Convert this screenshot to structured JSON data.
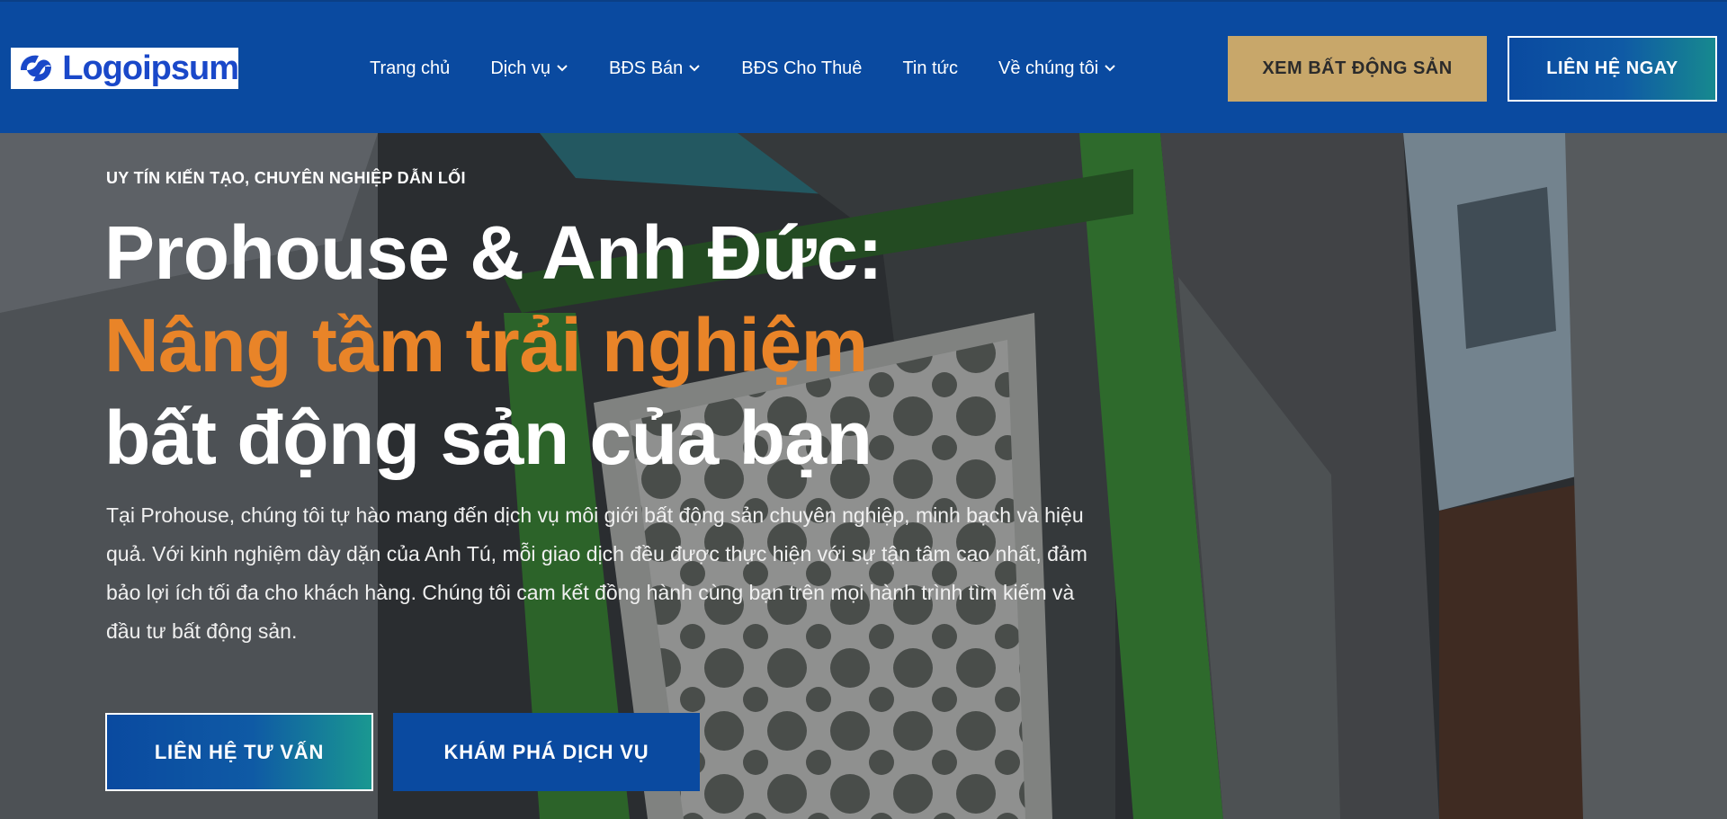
{
  "brand": {
    "logo_text": "Logoipsum",
    "primary_color": "#0a4aa0",
    "accent_gold": "#c8a76a",
    "accent_orange": "#e98428"
  },
  "nav": {
    "items": [
      {
        "label": "Trang chủ",
        "has_dropdown": false
      },
      {
        "label": "Dịch vụ",
        "has_dropdown": true
      },
      {
        "label": "BĐS Bán",
        "has_dropdown": true
      },
      {
        "label": "BĐS Cho Thuê",
        "has_dropdown": false
      },
      {
        "label": "Tin tức",
        "has_dropdown": false
      },
      {
        "label": "Về chúng tôi",
        "has_dropdown": true
      }
    ]
  },
  "header_buttons": {
    "view_property": "XEM BẤT ĐỘNG SẢN",
    "contact_now": "LIÊN HỆ NGAY"
  },
  "hero": {
    "kicker": "UY TÍN KIẾN TẠO, CHUYÊN NGHIỆP DẪN LỐI",
    "title_line1": "Prohouse & Anh Đức:",
    "title_line2": "Nâng tầm trải nghiệm",
    "title_line3": "bất động sản của bạn",
    "description": "Tại Prohouse, chúng tôi tự hào mang đến dịch vụ môi giới bất động sản chuyên nghiệp, minh bạch và hiệu quả. Với kinh nghiệm dày dặn của Anh Tú, mỗi giao dịch đều được thực hiện với sự tận tâm cao nhất, đảm bảo lợi ích tối đa cho khách hàng. Chúng tôi cam kết đồng hành cùng bạn trên mọi hành trình tìm kiếm và đầu tư bất động sản.",
    "btn_consult": "LIÊN HỆ TƯ VẤN",
    "btn_explore": "KHÁM PHÁ DỊCH VỤ"
  }
}
